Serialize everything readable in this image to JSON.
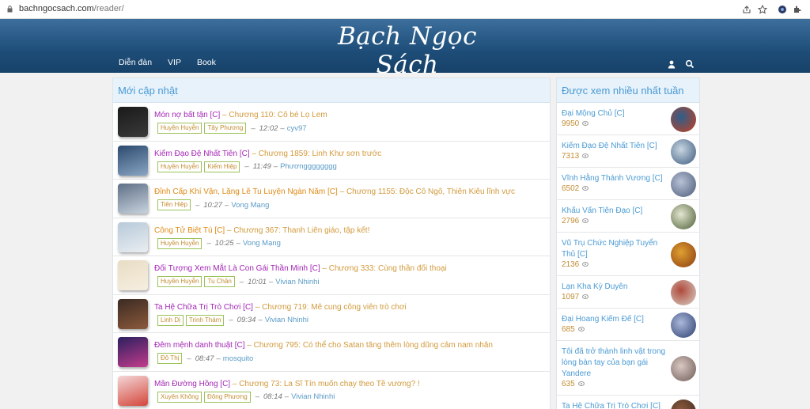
{
  "browser": {
    "url_host": "bachngocsach.com",
    "url_path": "/reader/"
  },
  "header": {
    "logo_text": "Bạch Ngọc Sách",
    "nav": [
      "Diễn đàn",
      "VIP",
      "Book"
    ]
  },
  "colors": {
    "header_top": "#3d6f9d",
    "header_bottom": "#174269",
    "link_blue": "#4a9ad3",
    "title_purple": "#a326b5",
    "title_orange": "#e08a16",
    "chapter_gold": "#d29a3c",
    "tag_border": "#9bc25a"
  },
  "latest": {
    "title": "Mới cập nhật",
    "rows": [
      {
        "name": "Món nợ bất tận [C]",
        "chapter": "Chương 110: Cô bé Lọ Lem",
        "tags": [
          "Huyền Huyễn",
          "Tây Phương"
        ],
        "time": "12:02",
        "user": "cyv97",
        "name_color": "#a326b5",
        "thumb": [
          "#1a1a1a",
          "#3a3a3a"
        ]
      },
      {
        "name": "Kiếm Đạo Đệ Nhất Tiên [C]",
        "chapter": "Chương 1859: Linh Khư sơn trước",
        "tags": [
          "Huyền Huyễn",
          "Kiếm Hiệp"
        ],
        "time": "11:49",
        "user": "Phươngggggggg",
        "name_color": "#a326b5",
        "thumb": [
          "#2c4a6e",
          "#8aa6c4"
        ]
      },
      {
        "name": "Đỉnh Cấp Khí Vận, Lặng Lẽ Tu Luyện Ngàn Năm [C]",
        "chapter": "Chương 1155: Độc Cô Ngô, Thiên Kiêu lĩnh vực",
        "tags": [
          "Tiên Hiệp"
        ],
        "time": "10:27",
        "user": "Vong Mạng",
        "name_color": "#e08a16",
        "thumb": [
          "#5e6f86",
          "#c9d3de"
        ]
      },
      {
        "name": "Công Tử Biệt Tú [C]",
        "chapter": "Chương 367: Thanh Liên giáo, tập kết!",
        "tags": [
          "Huyền Huyễn"
        ],
        "time": "10:25",
        "user": "Vong Mạng",
        "name_color": "#e08a16",
        "thumb": [
          "#b7c9d8",
          "#e9eef2"
        ]
      },
      {
        "name": "Đối Tượng Xem Mắt Là Con Gái Thần Minh [C]",
        "chapter": "Chương 333: Cùng thần đối thoại",
        "tags": [
          "Huyền Huyễn",
          "Tu Chân"
        ],
        "time": "10:01",
        "user": "Vivian Nhinhi",
        "name_color": "#a326b5",
        "thumb": [
          "#e8dcc4",
          "#f6efe0"
        ]
      },
      {
        "name": "Ta Hệ Chữa Trị Trò Chơi [C]",
        "chapter": "Chương 719: Mê cung công viên trò chơi",
        "tags": [
          "Linh Dị",
          "Trinh Thám"
        ],
        "time": "09:34",
        "user": "Vivian Nhinhi",
        "name_color": "#a326b5",
        "thumb": [
          "#3b2a22",
          "#8c5a3c"
        ]
      },
      {
        "name": "Đêm mệnh danh thuật [C]",
        "chapter": "Chương 795: Có thể cho Satan tăng thêm lòng dũng cảm nam nhân",
        "tags": [
          "Đô Thị"
        ],
        "time": "08:47",
        "user": "mosquito",
        "name_color": "#a326b5",
        "thumb": [
          "#2a1f5e",
          "#c43c8c"
        ]
      },
      {
        "name": "Mãn Đường Hồng [C]",
        "chapter": "Chương 73: La Sĩ Tín muốn chạy theo Tề vương? !",
        "tags": [
          "Xuyên Không",
          "Đông Phương"
        ],
        "time": "08:14",
        "user": "Vivian Nhinhi",
        "name_color": "#a326b5",
        "thumb": [
          "#f3d7d7",
          "#d4463b"
        ]
      }
    ]
  },
  "popular": {
    "title": "Được xem nhiều nhất tuần",
    "items": [
      {
        "name": "Đại Mộng Chủ [C]",
        "count": "9950",
        "avatar": [
          "#c73f1d",
          "#2d5e8c"
        ]
      },
      {
        "name": "Kiếm Đạo Đệ Nhất Tiên [C]",
        "count": "7313",
        "avatar": [
          "#3b5a7e",
          "#c9d6e2"
        ]
      },
      {
        "name": "Vĩnh Hằng Thánh Vương [C]",
        "count": "6502",
        "avatar": [
          "#4a5a78",
          "#b7c2d6"
        ]
      },
      {
        "name": "Khấu Vấn Tiên Đạo [C]",
        "count": "2796",
        "avatar": [
          "#4c5d36",
          "#e3e7d0"
        ]
      },
      {
        "name": "Vũ Trụ Chức Nghiệp Tuyển Thủ [C]",
        "count": "2136",
        "avatar": [
          "#8a3b12",
          "#e0a030"
        ]
      },
      {
        "name": "Lạn Kha Kỳ Duyên",
        "count": "1097",
        "avatar": [
          "#d8d2c8",
          "#b0493b"
        ]
      },
      {
        "name": "Đại Hoang Kiếm Đế [C]",
        "count": "685",
        "avatar": [
          "#2a3d6e",
          "#aab8da"
        ]
      },
      {
        "name": "Tôi đã trở thành linh vật trong lòng bàn tay của bạn gái Yandere",
        "count": "635",
        "avatar": [
          "#6d5a58",
          "#d9c8c2"
        ]
      },
      {
        "name": "Ta Hệ Chữa Trị Trò Chơi [C]",
        "count": "",
        "avatar": [
          "#3b2a22",
          "#8c5a3c"
        ]
      }
    ]
  }
}
